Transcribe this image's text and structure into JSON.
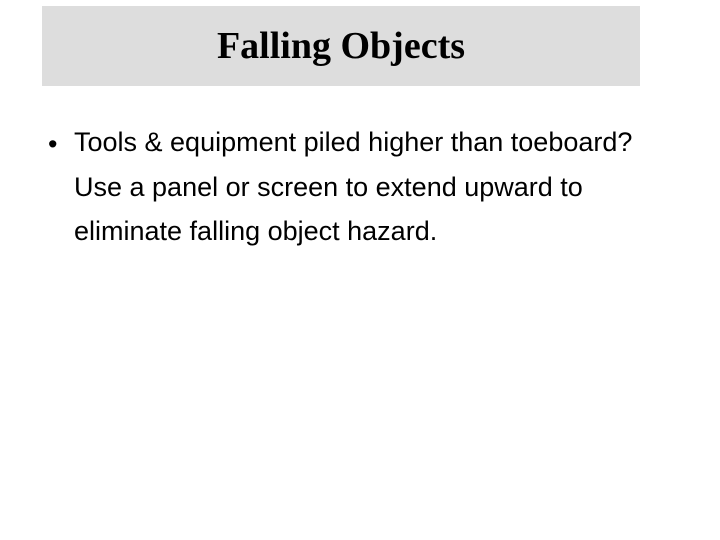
{
  "title": "Falling Objects",
  "bullets": [
    {
      "marker": "•",
      "text": "Tools & equipment piled higher than toeboard? Use a  panel or screen to extend upward to eliminate falling object hazard."
    }
  ]
}
